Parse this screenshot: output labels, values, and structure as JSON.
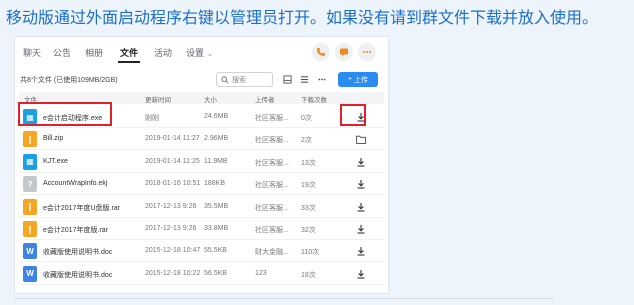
{
  "instruction": "移动版通过外面启动程序右键以管理员打开。如果没有请到群文件下载并放入使用。",
  "nav": {
    "tabs": [
      {
        "label": "聊天",
        "active": false
      },
      {
        "label": "公告",
        "active": false
      },
      {
        "label": "相册",
        "active": false
      },
      {
        "label": "文件",
        "active": true
      },
      {
        "label": "活动",
        "active": false
      },
      {
        "label": "设置",
        "active": false
      }
    ],
    "chevron": "⌄"
  },
  "toolbar": {
    "summary": "共8个文件 (已使用109MB/2GB)",
    "search_placeholder": "搜索",
    "upload_label": "上传"
  },
  "table": {
    "headers": {
      "name": "文件",
      "date": "更新时间",
      "size": "大小",
      "owner": "上传者",
      "count": "下载次数"
    },
    "rows": [
      {
        "name": "e会计启动程序.exe",
        "date": "刚刚",
        "size": "24.6MB",
        "owner": "社区客服...",
        "count": "0次",
        "icon": "exe-icon",
        "action": "download-icon"
      },
      {
        "name": "Bill.zip",
        "date": "2019-01-14 11:27",
        "size": "2.96MB",
        "owner": "社区客服...",
        "count": "2次",
        "icon": "zip-icon",
        "action": "folder-icon"
      },
      {
        "name": "KJT.exe",
        "date": "2019-01-14 11:25",
        "size": "11.9MB",
        "owner": "社区客服...",
        "count": "13次",
        "icon": "exe-icon",
        "action": "download-icon"
      },
      {
        "name": "AccountWrapInfo.ekj",
        "date": "2018-01-16 10:51",
        "size": "188KB",
        "owner": "社区客服...",
        "count": "19次",
        "icon": "unknown-file-icon",
        "action": "download-icon"
      },
      {
        "name": "e会计2017年度U盘版.rar",
        "date": "2017-12-13 9:26",
        "size": "35.5MB",
        "owner": "社区客服...",
        "count": "33次",
        "icon": "rar-icon",
        "action": "download-icon"
      },
      {
        "name": "e会计2017年度版.rar",
        "date": "2017-12-13 9:26",
        "size": "33.8MB",
        "owner": "社区客服...",
        "count": "32次",
        "icon": "rar-icon",
        "action": "download-icon"
      },
      {
        "name": "收藏版使用说明书.doc",
        "date": "2015-12-18 10:47",
        "size": "55.5KB",
        "owner": "财大金融...",
        "count": "110次",
        "icon": "doc-icon",
        "action": "download-icon"
      },
      {
        "name": "收藏版使用说明书.doc",
        "date": "2015-12-18 10:22",
        "size": "56.5KB",
        "owner": "123",
        "count": "18次",
        "icon": "doc-icon",
        "action": "download-icon"
      }
    ]
  },
  "colors": {
    "instruction": "#1a6ecc",
    "accent": "#2a8cf0",
    "highlight": "#e0202a",
    "exe": "#1ca0e4",
    "zip": "#f5a623",
    "unknown": "#c5c9cd",
    "doc": "#3f84e5"
  }
}
